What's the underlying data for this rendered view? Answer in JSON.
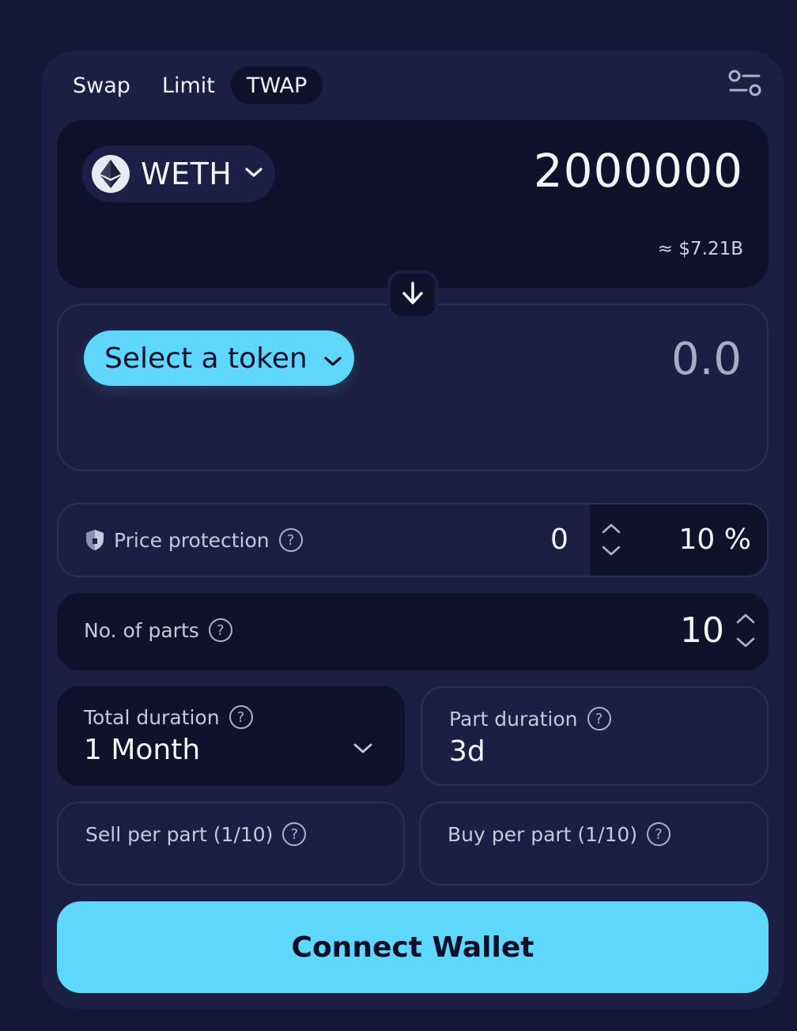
{
  "tabs": [
    {
      "label": "Swap",
      "active": false
    },
    {
      "label": "Limit",
      "active": false
    },
    {
      "label": "TWAP",
      "active": true
    }
  ],
  "from": {
    "token": "WETH",
    "token_icon": "ethereum-icon",
    "amount": "2000000",
    "usd_value": "≈ $7.21B"
  },
  "to": {
    "select_label": "Select a token",
    "amount": "0.0"
  },
  "price_protection": {
    "label": "Price protection",
    "value": "0",
    "percent": "10 %"
  },
  "parts": {
    "label": "No. of parts",
    "value": "10"
  },
  "total_duration": {
    "label": "Total duration",
    "value": "1 Month"
  },
  "part_duration": {
    "label": "Part duration",
    "value": "3d"
  },
  "sell_per_part": {
    "label": "Sell per part (1/10)"
  },
  "buy_per_part": {
    "label": "Buy per part (1/10)"
  },
  "connect_button": "Connect Wallet",
  "colors": {
    "background": "#131836",
    "card": "#1b1f43",
    "panel_dark": "#10122b",
    "accent": "#5fd7fb"
  }
}
